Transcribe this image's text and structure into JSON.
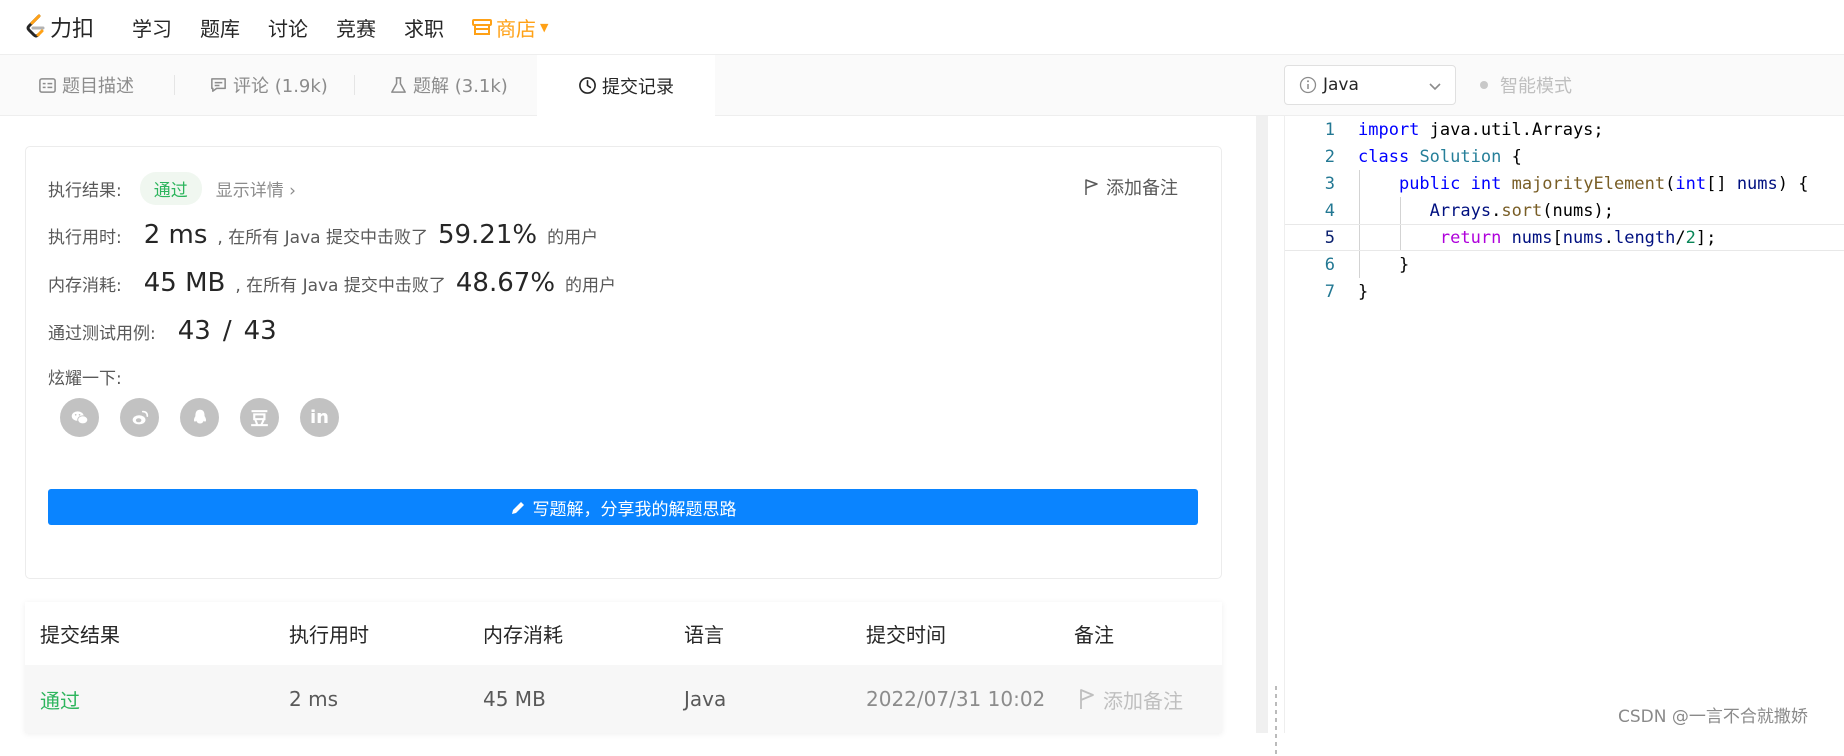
{
  "nav": {
    "logo_text": "力扣",
    "items": [
      "学习",
      "题库",
      "讨论",
      "竞赛",
      "求职"
    ],
    "shop": "商店",
    "accent": "#ffa116"
  },
  "tabs": [
    {
      "label": "题目描述",
      "icon": "description-icon"
    },
    {
      "label": "评论 (1.9k)",
      "icon": "comment-icon"
    },
    {
      "label": "题解 (3.1k)",
      "icon": "flask-icon"
    },
    {
      "label": "提交记录",
      "icon": "clock-icon",
      "active": true
    }
  ],
  "editor_toolbar": {
    "language": "Java",
    "smart_mode": "智能模式"
  },
  "result": {
    "status_label": "执行结果:",
    "status": "通过",
    "details_link": "显示详情",
    "add_note": "添加备注",
    "runtime_label": "执行用时:",
    "runtime_value": "2 ms",
    "runtime_text": ", 在所有 Java 提交中击败了",
    "runtime_percent": "59.21%",
    "runtime_suffix": "的用户",
    "memory_label": "内存消耗:",
    "memory_value": "45 MB",
    "memory_text": ", 在所有 Java 提交中击败了",
    "memory_percent": "48.67%",
    "memory_suffix": "的用户",
    "tests_label": "通过测试用例:",
    "tests_passed": "43",
    "tests_sep": "/",
    "tests_total": "43",
    "share_label": "炫耀一下:",
    "share_icons": [
      "wechat-icon",
      "weibo-icon",
      "qq-icon",
      "douban-icon",
      "linkedin-icon"
    ],
    "douban_glyph": "豆",
    "linkedin_glyph": "in",
    "write_solution": "写题解，分享我的解题思路",
    "button_color": "#0a84ff",
    "pass_color": "#2db55d"
  },
  "submissions": {
    "headers": [
      "提交结果",
      "执行用时",
      "内存消耗",
      "语言",
      "提交时间",
      "备注"
    ],
    "rows": [
      {
        "result": "通过",
        "runtime": "2 ms",
        "memory": "45 MB",
        "language": "Java",
        "time": "2022/07/31 10:02",
        "note": "添加备注"
      }
    ]
  },
  "code": {
    "line_numbers": [
      "1",
      "2",
      "3",
      "4",
      "5",
      "6",
      "7"
    ],
    "current_line": 5,
    "t1": {
      "a": "import",
      "b": " java.util.Arrays;"
    },
    "t2": {
      "a": "class",
      "b": " ",
      "c": "Solution",
      "d": " {"
    },
    "t3": {
      "a": "    ",
      "b": "public",
      "c": " ",
      "d": "int",
      "e": " ",
      "f": "majorityElement",
      "g": "(",
      "h": "int",
      "i": "[] ",
      "j": "nums",
      "k": ") {"
    },
    "t4": {
      "a": "       ",
      "b": "Arrays",
      "c": ".",
      "d": "sort",
      "e": "(nums);"
    },
    "t5": {
      "a": "        ",
      "b": "return",
      "c": " ",
      "d": "nums",
      "e": "[",
      "f": "nums",
      "g": ".",
      "h": "length",
      "i": "/",
      "j": "2",
      "k": "];"
    },
    "t6": {
      "a": "    }"
    },
    "t7": {
      "a": "}"
    }
  },
  "watermark": "CSDN @一言不合就撒娇"
}
